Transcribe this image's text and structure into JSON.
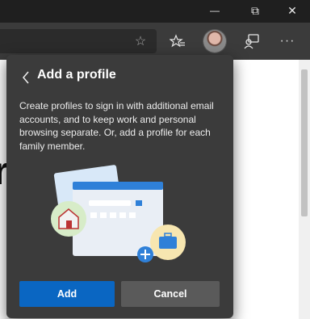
{
  "window": {
    "minimize_glyph": "—",
    "restore_glyph": "⧉",
    "close_glyph": "✕"
  },
  "toolbar": {
    "favorite_icon": "☆",
    "collections_icon": "☆≡",
    "feedback_icon": "feedback-icon",
    "more_glyph": "···"
  },
  "page": {
    "partial_glyph": "r"
  },
  "flyout": {
    "back_glyph": "<",
    "title": "Add a profile",
    "description": "Create profiles to sign in with additional email accounts, and to keep work and personal browsing separate. Or, add a profile for each family member.",
    "add_label": "Add",
    "cancel_label": "Cancel"
  },
  "colors": {
    "primary": "#0a66c2",
    "flyout_bg": "#3b3b3b"
  }
}
